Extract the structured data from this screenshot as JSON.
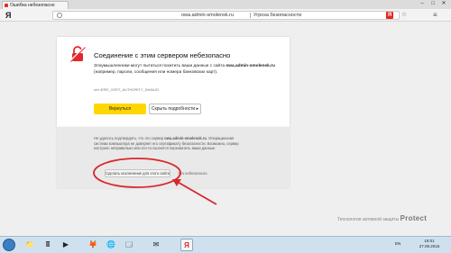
{
  "tab": {
    "title": "Ошибка небезопасно"
  },
  "window": {
    "minimize": "–",
    "maximize": "□",
    "close": "✕"
  },
  "toolbar": {
    "logo": "Я",
    "url": "owa.admin-smolensk.ru",
    "page_name": "Угроза безопасности",
    "ya_badge": "Я",
    "star": "☆",
    "menu": "≡"
  },
  "error": {
    "title": "Соединение с этим сервером небезопасно",
    "desc_prefix": "Злоумышленники могут пытаться похитить ваши данные с сайта ",
    "desc_host": "owa.admin-smolensk.ru",
    "desc_suffix": " (например, пароли, сообщения или номера банковских карт).",
    "code": "net::ERR_CERT_AUTHORITY_INVALID",
    "back_button": "Вернуться",
    "details_button": "Скрыть подробности ▸"
  },
  "details": {
    "text_prefix": "Не удалось подтвердить, что это сервер ",
    "text_host": "owa.admin-smolensk.ru",
    "text_suffix": ". Операционная система компьютера не доверяет его сертификату безопасности. Возможно, сервер настроен неправильно или кто-то пытается перехватить ваши данные.",
    "exception_button": "Сделать исключение для этого сайта",
    "unsafe_note": "Это небезопасно."
  },
  "protect": {
    "label": "Технология активной защиты",
    "brand": "Protect"
  },
  "taskbar": {
    "items": [
      "📁",
      "🖩",
      "▶",
      "🦊",
      "🌐",
      "🗔",
      "✉",
      "Я"
    ],
    "lang": "EN",
    "time": "18:01",
    "date": "27.09.2016"
  },
  "colors": {
    "accent_yellow": "#ffd600",
    "annotation_red": "#d9262c",
    "brand_red": "#e52620"
  }
}
